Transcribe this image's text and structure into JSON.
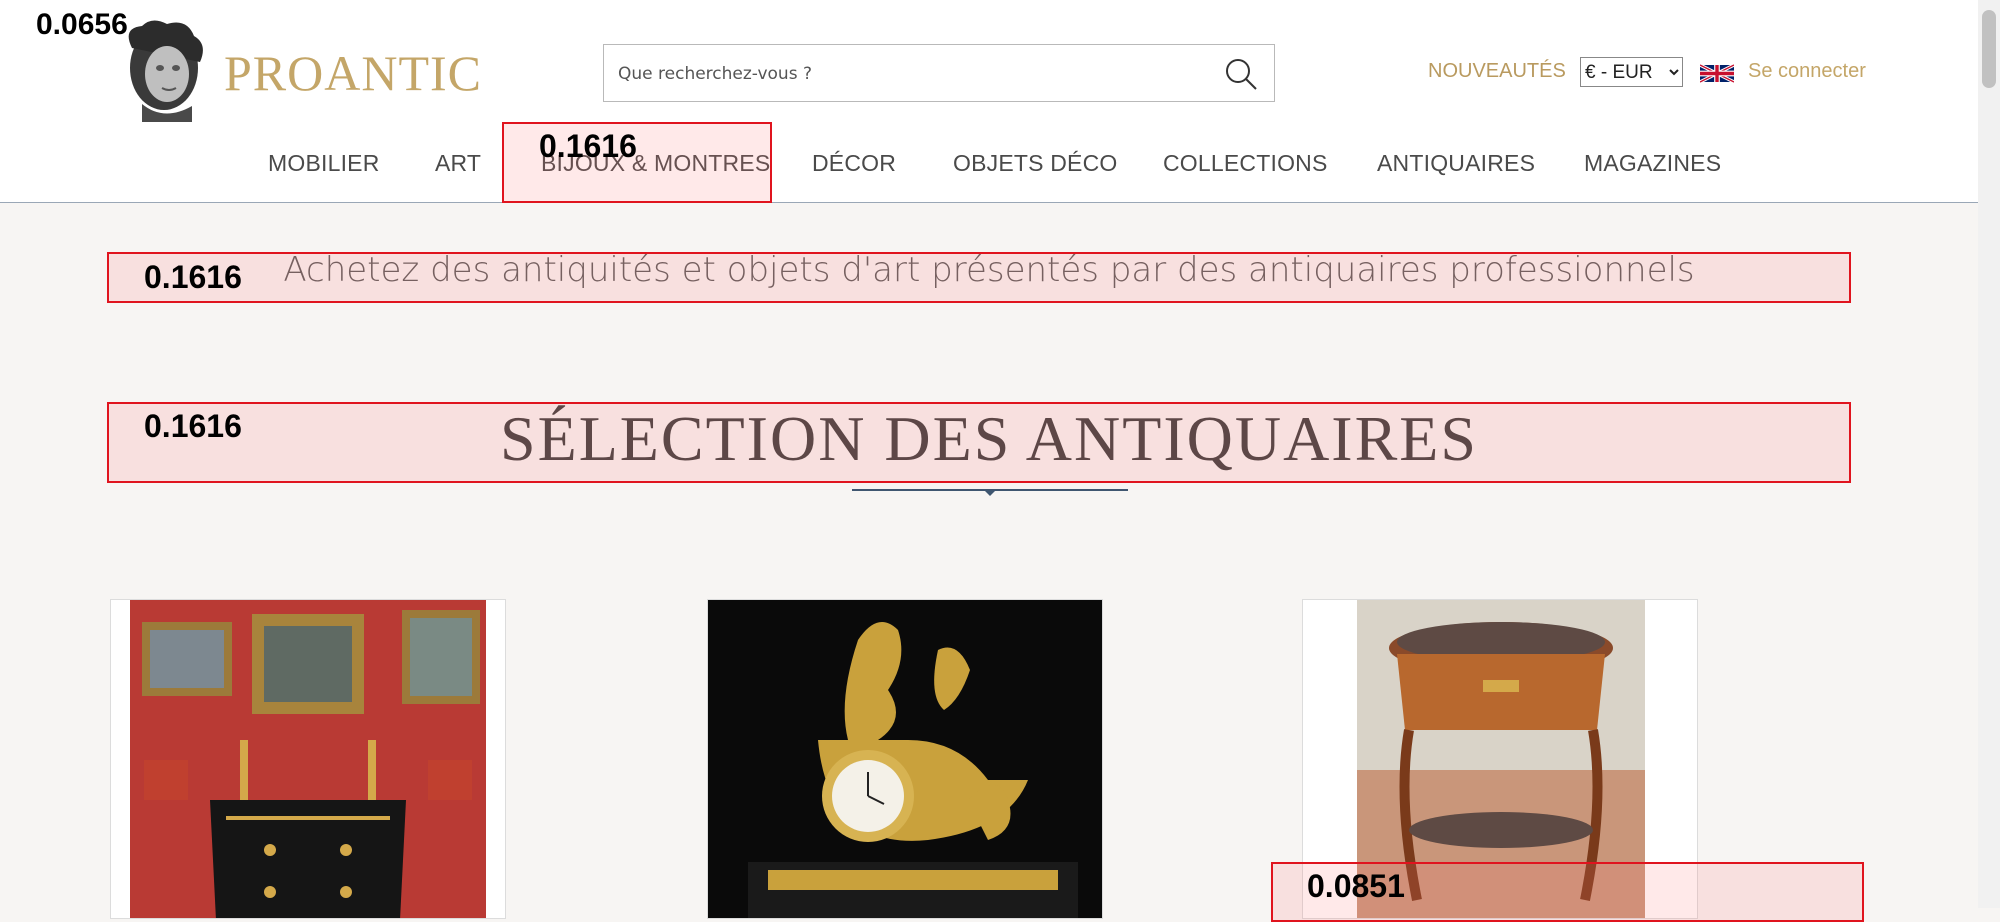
{
  "overlay_scores": {
    "top_left": "0.0656",
    "nav_item": "0.1616",
    "tagline": "0.1616",
    "section_title": "0.1616",
    "card": "0.0851"
  },
  "header": {
    "logo_text": "PROANTIC",
    "search_placeholder": "Que recherchez-vous ?",
    "nouveautes": "NOUVEAUTÉS",
    "currency": "€ - EUR",
    "login": "Se connecter"
  },
  "nav": {
    "items": [
      {
        "label": "MOBILIER"
      },
      {
        "label": "ART"
      },
      {
        "label": "BIJOUX & MONTRES"
      },
      {
        "label": "DÉCOR"
      },
      {
        "label": "OBJETS DÉCO"
      },
      {
        "label": "COLLECTIONS"
      },
      {
        "label": "ANTIQUAIRES"
      },
      {
        "label": "MAGAZINES"
      }
    ]
  },
  "main": {
    "tagline": "Achetez des antiquités et objets d'art présentés par des antiquaires professionnels",
    "section_title": "SÉLECTION DES ANTIQUAIRES"
  },
  "colors": {
    "gold": "#c4a668",
    "highlight": "#e0141e",
    "divider": "#3f5670"
  },
  "icons": [
    "logo-bust-icon",
    "search-icon",
    "uk-flag-icon",
    "chevron-down-icon"
  ]
}
